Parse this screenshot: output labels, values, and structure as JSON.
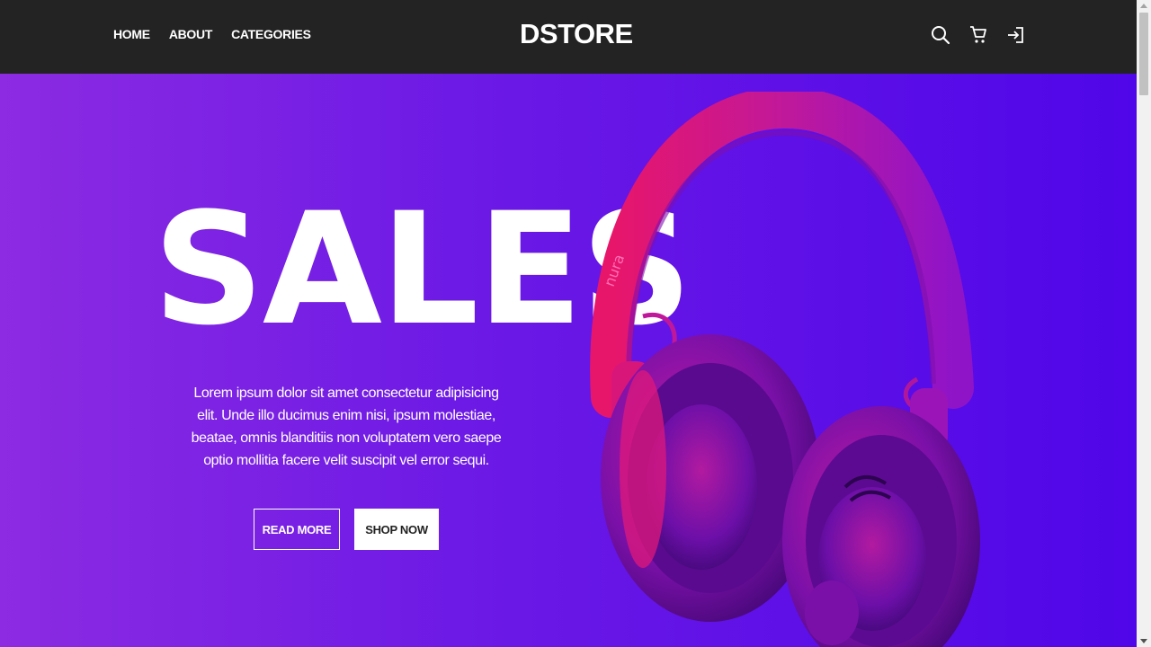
{
  "nav": {
    "links": [
      "HOME",
      "ABOUT",
      "CATEGORIES"
    ],
    "brand": "DSTORE",
    "icons": [
      "search-icon",
      "cart-icon",
      "login-icon"
    ]
  },
  "hero": {
    "title": "SALES",
    "description": "Lorem ipsum dolor sit amet consectetur adipisicing elit. Unde illo ducimus enim nisi, ipsum molestiae, beatae, omnis blanditiis non voluptatem vero saepe optio mollitia facere velit suscipit vel error sequi.",
    "read_more_label": "READ MORE",
    "shop_now_label": "SHOP NOW",
    "product_brand_text": "nura"
  },
  "colors": {
    "navbar": "#232323",
    "gradient_start": "#8c2be2",
    "gradient_end": "#4f06e8",
    "headphone_pink": "#e8166a"
  }
}
